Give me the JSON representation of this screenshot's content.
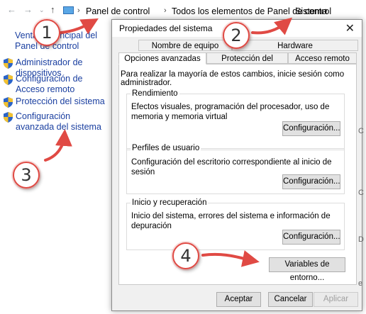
{
  "explorer": {
    "breadcrumb": [
      "Panel de control",
      "Todos los elementos de Panel de control",
      "Sistema"
    ],
    "main_link": "Ventana principal del Panel de control",
    "left_items": [
      "Administrador de dispositivos",
      "Configuración de Acceso remoto",
      "Protección del sistema",
      "Configuración avanzada del sistema"
    ]
  },
  "dialog": {
    "title": "Propiedades del sistema",
    "close_glyph": "✕",
    "tabs_back": [
      "Nombre de equipo",
      "Hardware"
    ],
    "tabs_front": [
      "Opciones avanzadas",
      "Protección del sistema",
      "Acceso remoto"
    ],
    "active_tab": "Opciones avanzadas",
    "admin_note": "Para realizar la mayoría de estos cambios, inicie sesión como administrador.",
    "groups": [
      {
        "title": "Rendimiento",
        "text": "Efectos visuales, programación del procesador, uso de memoria y memoria virtual",
        "button": "Configuración..."
      },
      {
        "title": "Perfiles de usuario",
        "text": "Configuración del escritorio correspondiente al inicio de sesión",
        "button": "Configuración..."
      },
      {
        "title": "Inicio y recuperación",
        "text": "Inicio del sistema, errores del sistema e información de depuración",
        "button": "Configuración..."
      }
    ],
    "env_button": "Variables de entorno...",
    "footer": {
      "ok": "Aceptar",
      "cancel": "Cancelar",
      "apply": "Aplicar"
    }
  },
  "annotations": {
    "callouts": [
      "1",
      "2",
      "3",
      "4"
    ],
    "color": "#e04a44"
  }
}
